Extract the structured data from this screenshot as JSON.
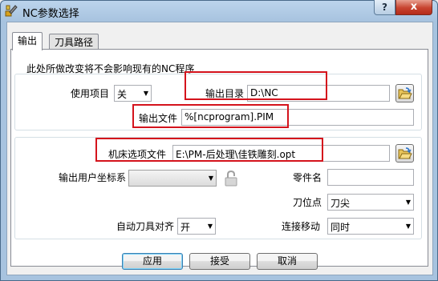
{
  "window": {
    "title": "NC参数选择",
    "help_label": "?",
    "close_label": "x"
  },
  "tabs": [
    {
      "label": "输出",
      "active": true
    },
    {
      "label": "刀具路径",
      "active": false
    }
  ],
  "notice": "此处所做改变将不会影响现有的NC程序",
  "fields": {
    "use_item": {
      "label": "使用项目",
      "value": "关"
    },
    "output_dir": {
      "label": "输出目录",
      "value": "D:\\NC"
    },
    "output_file": {
      "label": "输出文件",
      "value": "%[ncprogram].PIM"
    },
    "machine_option_file": {
      "label": "机床选项文件",
      "value": "E:\\PM-后处理\\佳铁雕刻.opt"
    },
    "output_user_cs": {
      "label": "输出用户坐标系",
      "value": ""
    },
    "part_name": {
      "label": "零件名",
      "value": ""
    },
    "tool_position": {
      "label": "刀位点",
      "value": "刀尖"
    },
    "auto_tool_align": {
      "label": "自动刀具对齐",
      "value": "开"
    },
    "connect_move": {
      "label": "连接移动",
      "value": "同时"
    }
  },
  "buttons": {
    "apply": "应用",
    "accept": "接受",
    "cancel": "取消"
  },
  "icons": {
    "app": "app-tool-icon",
    "browse": "folder-open-icon",
    "lock": "lock-icon"
  },
  "colors": {
    "highlight": "#d4131c",
    "title_bar": "#a7c3df"
  }
}
